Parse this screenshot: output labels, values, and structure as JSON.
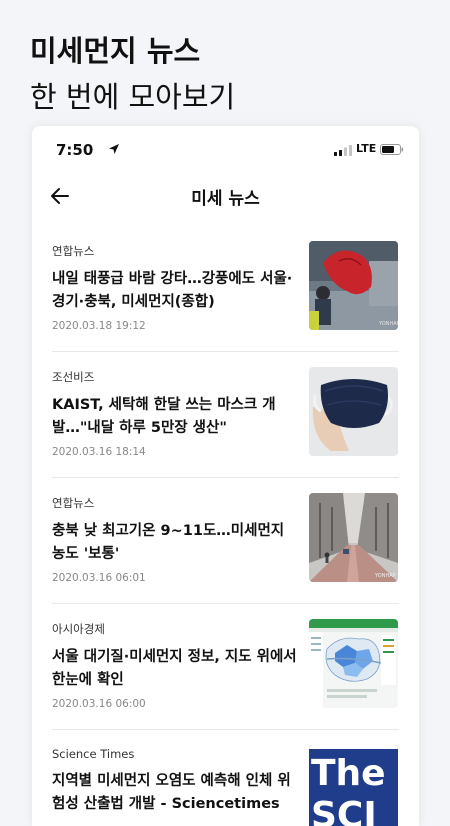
{
  "promo": {
    "title": "미세먼지 뉴스",
    "subtitle": "한 번에 모아보기"
  },
  "status_bar": {
    "time": "7:50",
    "network": "LTE"
  },
  "nav": {
    "title": "미세 뉴스",
    "back_icon": "arrow-left-icon"
  },
  "news": [
    {
      "source": "연합뉴스",
      "title": "내일 태풍급 바람 강타…강풍에도 서울·경기·충북, 미세먼지(종합)",
      "date": "2020.03.18 19:12",
      "thumbnail": "umbrella-in-wind-photo"
    },
    {
      "source": "조선비즈",
      "title": "KAIST, 세탁해 한달 쓰는 마스크 개발…\"내달 하루 5만장 생산\"",
      "date": "2020.03.16 18:14",
      "thumbnail": "navy-face-mask-photo"
    },
    {
      "source": "연합뉴스",
      "title": "충북 낮 최고기온 9~11도…미세먼지 농도 '보통'",
      "date": "2020.03.16 06:01",
      "thumbnail": "tree-lined-road-photo"
    },
    {
      "source": "아시아경제",
      "title": "서울 대기질·미세먼지 정보, 지도 위에서 한눈에 확인",
      "date": "2020.03.16 06:00",
      "thumbnail": "air-quality-map-screenshot"
    },
    {
      "source": "Science Times",
      "title": "지역별 미세먼지 오염도 예측해 인체 위험성 산출법 개발 - Sciencetimes",
      "date": "",
      "thumbnail": "science-times-logo"
    }
  ]
}
